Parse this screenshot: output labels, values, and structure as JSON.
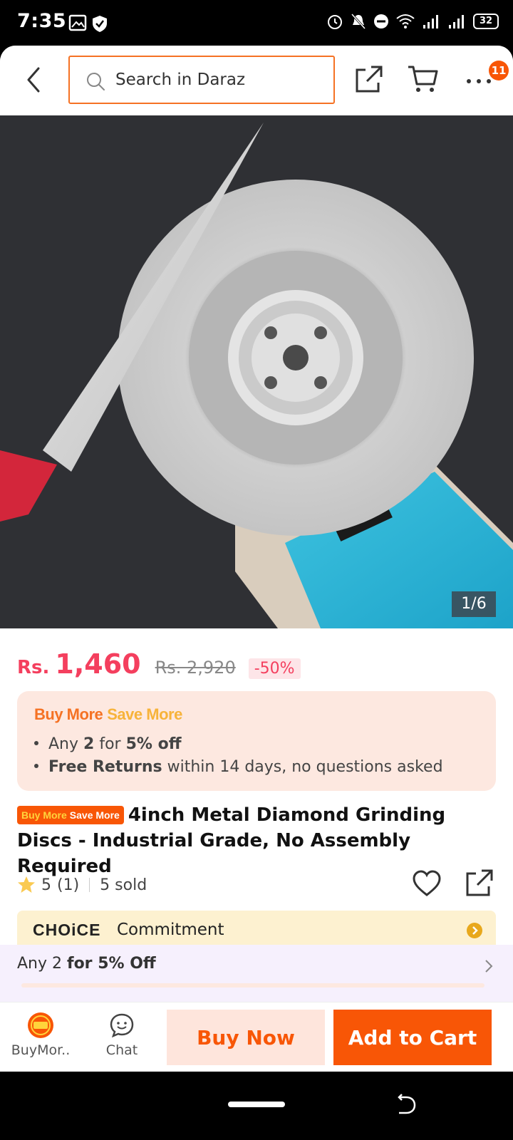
{
  "status_bar": {
    "time": "7:35",
    "battery": "32"
  },
  "header": {
    "search_placeholder": "Search in Daraz",
    "cart_badge": "11"
  },
  "gallery": {
    "counter": "1/6"
  },
  "price": {
    "currency": "Rs.",
    "current": "1,460",
    "original": "Rs. 2,920",
    "discount": "-50%"
  },
  "promo": {
    "logo_part1": "Buy More",
    "logo_part2": "Save More",
    "line1_a": "Any ",
    "line1_b": "2",
    "line1_c": " for ",
    "line1_d": "5% off",
    "line2_a": "Free Returns",
    "line2_b": " within 14 days, no questions asked"
  },
  "product": {
    "tag_part1": "Buy More",
    "tag_part2": "Save More",
    "title": "4inch Metal Diamond Grinding Discs - Industrial Grade, No Assembly Required",
    "rating": "5",
    "rating_count": "(1)",
    "sold": "5 sold"
  },
  "choice": {
    "logo": "CHOiCE",
    "text": "Commitment"
  },
  "offer": {
    "text_a": "Any 2 ",
    "text_b": "for 5% Off"
  },
  "bottom_bar": {
    "buymore_label": "BuyMor..",
    "chat_label": "Chat",
    "buy_now": "Buy Now",
    "add_to_cart": "Add to Cart"
  },
  "colors": {
    "accent": "#f85606",
    "price": "#f43f5e"
  }
}
